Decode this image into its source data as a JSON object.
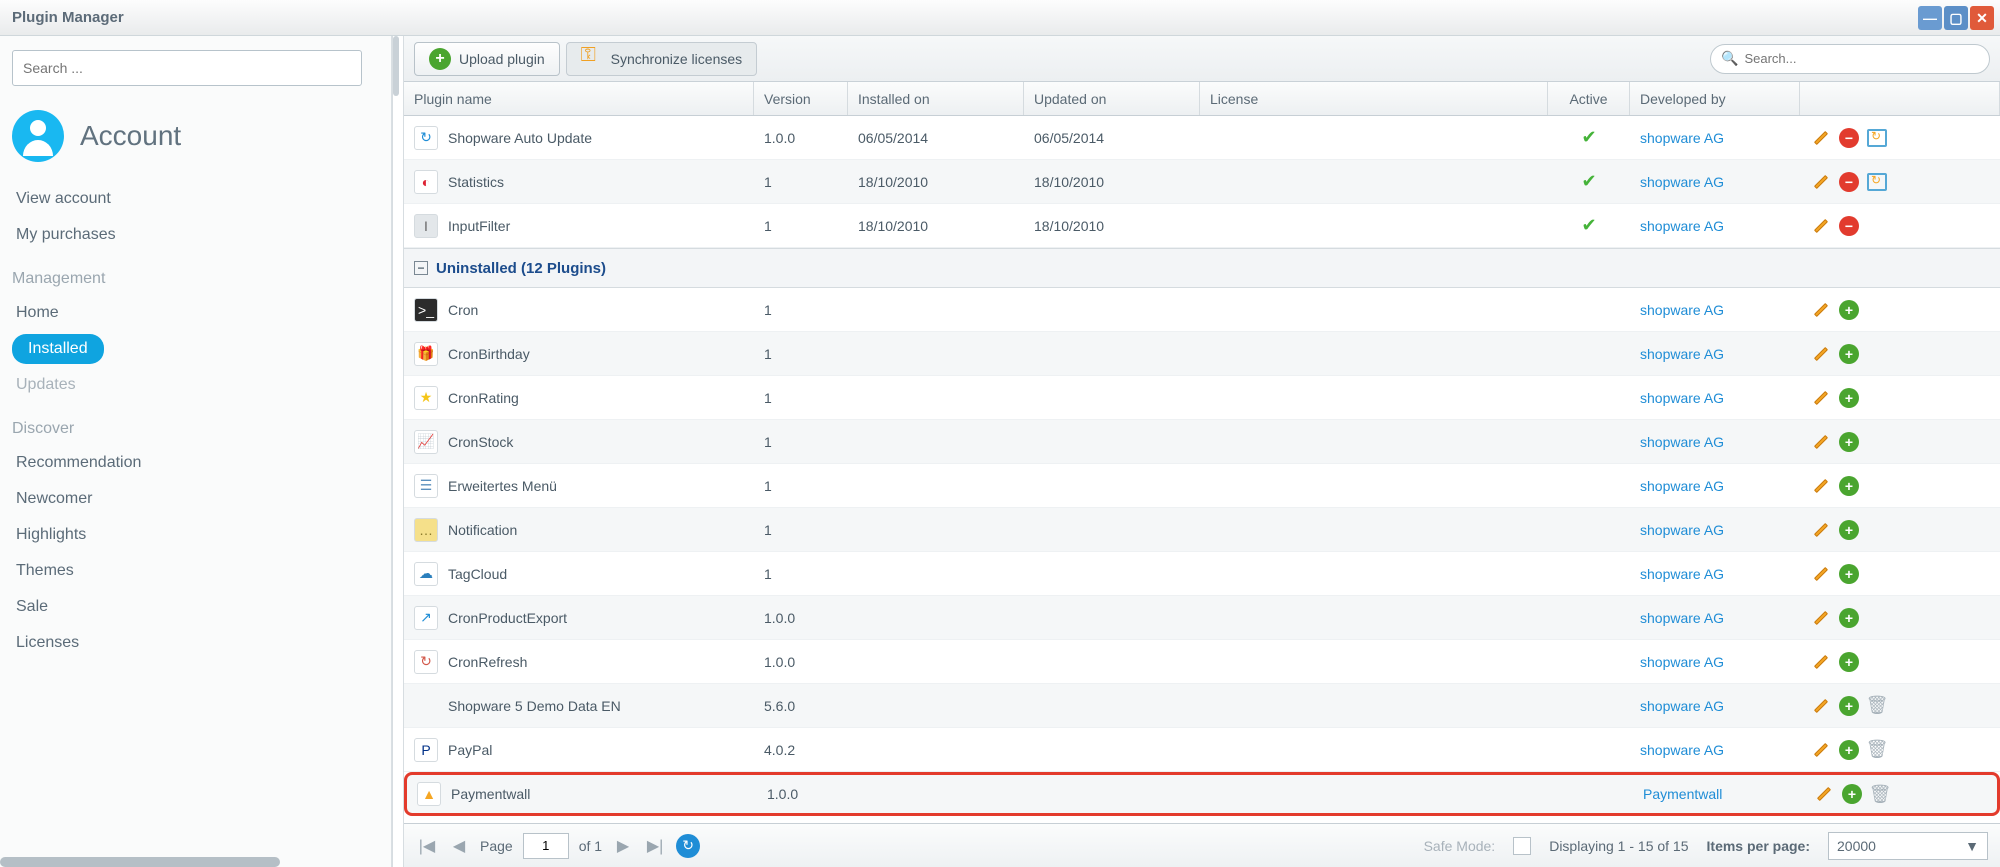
{
  "window": {
    "title": "Plugin Manager"
  },
  "sidebar": {
    "search_placeholder": "Search ...",
    "account_label": "Account",
    "account_links": [
      "View account",
      "My purchases"
    ],
    "management_header": "Management",
    "management_links": [
      {
        "label": "Home",
        "active": false
      },
      {
        "label": "Installed",
        "active": true
      },
      {
        "label": "Updates",
        "active": false,
        "muted": true
      }
    ],
    "discover_header": "Discover",
    "discover_links": [
      "Recommendation",
      "Newcomer",
      "Highlights",
      "Themes",
      "Sale",
      "Licenses"
    ]
  },
  "toolbar": {
    "upload_label": "Upload plugin",
    "sync_label": "Synchronize licenses",
    "search_placeholder": "Search..."
  },
  "columns": {
    "name": "Plugin name",
    "version": "Version",
    "installed": "Installed on",
    "updated": "Updated on",
    "license": "License",
    "active": "Active",
    "dev": "Developed by"
  },
  "installed_rows": [
    {
      "name": "Shopware Auto Update",
      "version": "1.0.0",
      "installed": "06/05/2014",
      "updated": "06/05/2014",
      "active": true,
      "dev": "shopware AG",
      "icon_bg": "#ffffff",
      "icon_char": "↻",
      "icon_color": "#1f8dd6",
      "extra_refresh": true
    },
    {
      "name": "Statistics",
      "version": "1",
      "installed": "18/10/2010",
      "updated": "18/10/2010",
      "active": true,
      "dev": "shopware AG",
      "icon_bg": "#ffffff",
      "icon_char": "◐",
      "icon_color": "#d23",
      "extra_refresh": true
    },
    {
      "name": "InputFilter",
      "version": "1",
      "installed": "18/10/2010",
      "updated": "18/10/2010",
      "active": true,
      "dev": "shopware AG",
      "icon_bg": "#e3e7ea",
      "icon_char": "I",
      "icon_color": "#666",
      "extra_refresh": false
    }
  ],
  "group": {
    "label": "Uninstalled (12 Plugins)"
  },
  "uninstalled_rows": [
    {
      "name": "Cron",
      "version": "1",
      "dev": "shopware AG",
      "icon_bg": "#2b2b2b",
      "icon_char": ">_",
      "icon_color": "#fff",
      "trash": false
    },
    {
      "name": "CronBirthday",
      "version": "1",
      "dev": "shopware AG",
      "icon_bg": "#ffffff",
      "icon_char": "🎁",
      "icon_color": "#d23",
      "trash": false
    },
    {
      "name": "CronRating",
      "version": "1",
      "dev": "shopware AG",
      "icon_bg": "#ffffff",
      "icon_char": "★",
      "icon_color": "#f5c518",
      "trash": false
    },
    {
      "name": "CronStock",
      "version": "1",
      "dev": "shopware AG",
      "icon_bg": "#ffffff",
      "icon_char": "📈",
      "icon_color": "#1f8dd6",
      "trash": false
    },
    {
      "name": "Erweitertes Menü",
      "version": "1",
      "dev": "shopware AG",
      "icon_bg": "#ffffff",
      "icon_char": "☰",
      "icon_color": "#5a8fbd",
      "trash": false
    },
    {
      "name": "Notification",
      "version": "1",
      "dev": "shopware AG",
      "icon_bg": "#f5e08a",
      "icon_char": "…",
      "icon_color": "#8a7a2a",
      "trash": false
    },
    {
      "name": "TagCloud",
      "version": "1",
      "dev": "shopware AG",
      "icon_bg": "#ffffff",
      "icon_char": "☁",
      "icon_color": "#2a7fbd",
      "trash": false
    },
    {
      "name": "CronProductExport",
      "version": "1.0.0",
      "dev": "shopware AG",
      "icon_bg": "#ffffff",
      "icon_char": "↗",
      "icon_color": "#1f8dd6",
      "trash": false
    },
    {
      "name": "CronRefresh",
      "version": "1.0.0",
      "dev": "shopware AG",
      "icon_bg": "#ffffff",
      "icon_char": "↻",
      "icon_color": "#d2584a",
      "trash": false
    },
    {
      "name": "Shopware 5 Demo Data EN",
      "version": "5.6.0",
      "dev": "shopware AG",
      "icon_bg": "",
      "icon_char": "",
      "icon_color": "",
      "trash": true,
      "no_icon": true
    },
    {
      "name": "PayPal",
      "version": "4.0.2",
      "dev": "shopware AG",
      "icon_bg": "#ffffff",
      "icon_char": "P",
      "icon_color": "#003087",
      "trash": true
    },
    {
      "name": "Paymentwall",
      "version": "1.0.0",
      "dev": "Paymentwall",
      "icon_bg": "#ffffff",
      "icon_char": "▲",
      "icon_color": "#f5a623",
      "trash": true,
      "highlight": true
    }
  ],
  "footer": {
    "page_label": "Page",
    "page_value": "1",
    "of_label": "of 1",
    "safe_mode": "Safe Mode:",
    "display": "Displaying 1 - 15 of 15",
    "items_per_page": "Items per page:",
    "items_value": "20000"
  }
}
